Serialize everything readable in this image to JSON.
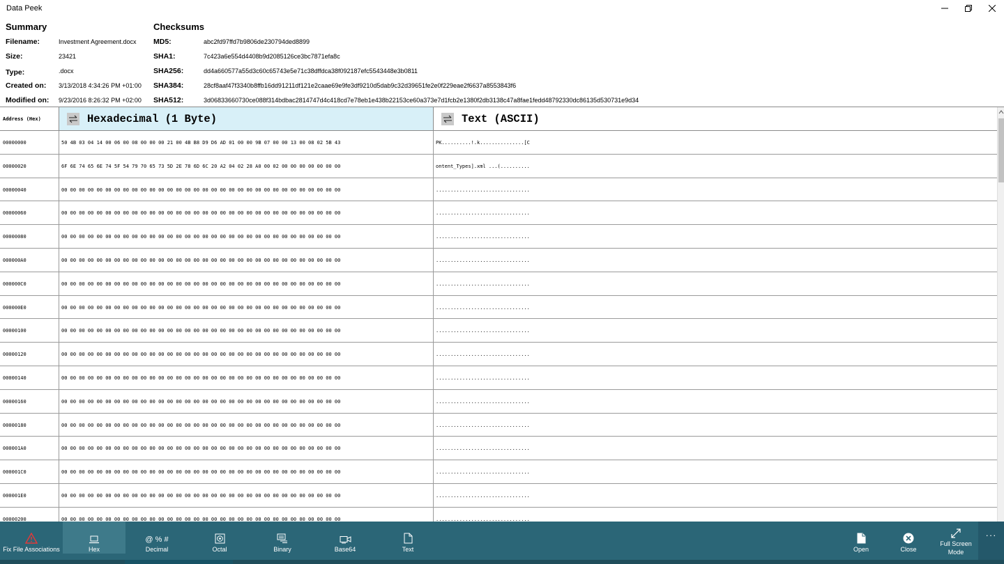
{
  "window": {
    "title": "Data Peek"
  },
  "summary": {
    "heading": "Summary",
    "rows": [
      {
        "label": "Filename:",
        "value": "Investment Agreement.docx"
      },
      {
        "label": "Size:",
        "value": "23421"
      },
      {
        "label": "Type:",
        "value": ".docx"
      },
      {
        "label": "Created on:",
        "value": "3/13/2018 4:34:26 PM +01:00"
      },
      {
        "label": "Modified on:",
        "value": "9/23/2016 8:26:32 PM +02:00"
      }
    ]
  },
  "checksums": {
    "heading": "Checksums",
    "rows": [
      {
        "label": "MD5:",
        "value": "abc2fd97ffd7b9806de230794ded8899"
      },
      {
        "label": "SHA1:",
        "value": "7c423a6e554d4408b9d2085126ce3bc7871efa8c"
      },
      {
        "label": "SHA256:",
        "value": "dd4a660577a55d3c60c65743e5e71c38dffdca38f092187efc5543448e3b0811"
      },
      {
        "label": "SHA384:",
        "value": "28cf8aaf47f3340b8ffb16dd91211df121e2caae69e9fe3df9210d5dab9c32d39651fe2e0f229eae2f6637a8553843f6"
      },
      {
        "label": "SHA512:",
        "value": "3d06833660730ce088f314bdbac2814747d4c418cd7e78eb1e438b22153ce60a373e7d1fcb2e1380f2db3138c47a8fae1fedd48792330dc86135d530731e9d34"
      }
    ]
  },
  "grid": {
    "address_header": "Address (Hex)",
    "hex_header": "Hexadecimal (1 Byte)",
    "text_header": "Text (ASCII)",
    "rows": [
      {
        "addr": "00000000",
        "hex": "50 4B 03 04 14 00 06 00 08 00 00 00 21 00 4B B8 D9 D6 AD 01 00 00 9B 07 00 00 13 00 08 02 5B 43",
        "text": "PK..........!.k...............[C"
      },
      {
        "addr": "00000020",
        "hex": "6F 6E 74 65 6E 74 5F 54 79 70 65 73 5D 2E 78 6D 6C 20 A2 04 02 28 A0 00 02 00 00 00 00 00 00 00",
        "text": "ontent_Types].xml ...(.........."
      },
      {
        "addr": "00000040",
        "hex": "00 00 00 00 00 00 00 00 00 00 00 00 00 00 00 00 00 00 00 00 00 00 00 00 00 00 00 00 00 00 00 00",
        "text": "................................"
      },
      {
        "addr": "00000060",
        "hex": "00 00 00 00 00 00 00 00 00 00 00 00 00 00 00 00 00 00 00 00 00 00 00 00 00 00 00 00 00 00 00 00",
        "text": "................................"
      },
      {
        "addr": "00000080",
        "hex": "00 00 00 00 00 00 00 00 00 00 00 00 00 00 00 00 00 00 00 00 00 00 00 00 00 00 00 00 00 00 00 00",
        "text": "................................"
      },
      {
        "addr": "000000A0",
        "hex": "00 00 00 00 00 00 00 00 00 00 00 00 00 00 00 00 00 00 00 00 00 00 00 00 00 00 00 00 00 00 00 00",
        "text": "................................"
      },
      {
        "addr": "000000C0",
        "hex": "00 00 00 00 00 00 00 00 00 00 00 00 00 00 00 00 00 00 00 00 00 00 00 00 00 00 00 00 00 00 00 00",
        "text": "................................"
      },
      {
        "addr": "000000E0",
        "hex": "00 00 00 00 00 00 00 00 00 00 00 00 00 00 00 00 00 00 00 00 00 00 00 00 00 00 00 00 00 00 00 00",
        "text": "................................"
      },
      {
        "addr": "00000100",
        "hex": "00 00 00 00 00 00 00 00 00 00 00 00 00 00 00 00 00 00 00 00 00 00 00 00 00 00 00 00 00 00 00 00",
        "text": "................................"
      },
      {
        "addr": "00000120",
        "hex": "00 00 00 00 00 00 00 00 00 00 00 00 00 00 00 00 00 00 00 00 00 00 00 00 00 00 00 00 00 00 00 00",
        "text": "................................"
      },
      {
        "addr": "00000140",
        "hex": "00 00 00 00 00 00 00 00 00 00 00 00 00 00 00 00 00 00 00 00 00 00 00 00 00 00 00 00 00 00 00 00",
        "text": "................................"
      },
      {
        "addr": "00000160",
        "hex": "00 00 00 00 00 00 00 00 00 00 00 00 00 00 00 00 00 00 00 00 00 00 00 00 00 00 00 00 00 00 00 00",
        "text": "................................"
      },
      {
        "addr": "00000180",
        "hex": "00 00 00 00 00 00 00 00 00 00 00 00 00 00 00 00 00 00 00 00 00 00 00 00 00 00 00 00 00 00 00 00",
        "text": "................................"
      },
      {
        "addr": "000001A0",
        "hex": "00 00 00 00 00 00 00 00 00 00 00 00 00 00 00 00 00 00 00 00 00 00 00 00 00 00 00 00 00 00 00 00",
        "text": "................................"
      },
      {
        "addr": "000001C0",
        "hex": "00 00 00 00 00 00 00 00 00 00 00 00 00 00 00 00 00 00 00 00 00 00 00 00 00 00 00 00 00 00 00 00",
        "text": "................................"
      },
      {
        "addr": "000001E0",
        "hex": "00 00 00 00 00 00 00 00 00 00 00 00 00 00 00 00 00 00 00 00 00 00 00 00 00 00 00 00 00 00 00 00",
        "text": "................................"
      },
      {
        "addr": "00000200",
        "hex": "00 00 00 00 00 00 00 00 00 00 00 00 00 00 00 00 00 00 00 00 00 00 00 00 00 00 00 00 00 00 00 00",
        "text": "................................"
      }
    ]
  },
  "commandbar": {
    "buttons": [
      {
        "id": "fix",
        "label": "Fix File Associations",
        "icon": "warning-icon",
        "active": false
      },
      {
        "id": "hex",
        "label": "Hex",
        "icon": "laptop-icon",
        "active": true
      },
      {
        "id": "decimal",
        "label": "Decimal",
        "icon": "symbols-icon",
        "glyph": "@ % #",
        "active": false
      },
      {
        "id": "octal",
        "label": "Octal",
        "icon": "target-icon",
        "active": false
      },
      {
        "id": "binary",
        "label": "Binary",
        "icon": "keyboard-icon",
        "active": false
      },
      {
        "id": "base64",
        "label": "Base64",
        "icon": "video-icon",
        "active": false
      },
      {
        "id": "text",
        "label": "Text",
        "icon": "document-icon",
        "active": false
      },
      {
        "id": "open",
        "label": "Open",
        "icon": "file-icon",
        "active": false
      },
      {
        "id": "close",
        "label": "Close",
        "icon": "close-circle-icon",
        "active": false
      },
      {
        "id": "fullscreen",
        "label": "Full Screen\nMode",
        "icon": "expand-icon",
        "active": false
      }
    ],
    "more": "···"
  },
  "colors": {
    "commandbar": "#2b6677",
    "active_button": "#3e7a8a",
    "hex_header_bg": "#d8f0f8",
    "warning": "#e03a3a"
  }
}
